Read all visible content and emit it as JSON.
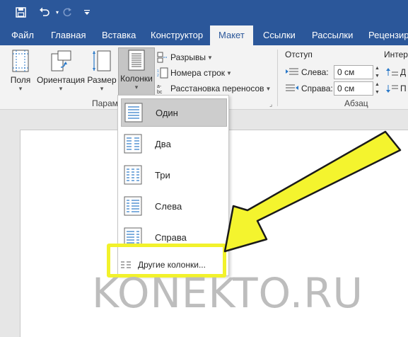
{
  "quick_access": {
    "save_icon": "save-icon",
    "undo_icon": "undo-icon",
    "redo_icon": "redo-icon",
    "customize_icon": "customize-qat-icon"
  },
  "tabs": [
    {
      "label": "Файл",
      "active": false
    },
    {
      "label": "Главная",
      "active": false
    },
    {
      "label": "Вставка",
      "active": false
    },
    {
      "label": "Конструктор",
      "active": false
    },
    {
      "label": "Макет",
      "active": true
    },
    {
      "label": "Ссылки",
      "active": false
    },
    {
      "label": "Рассылки",
      "active": false
    },
    {
      "label": "Рецензиро",
      "active": false
    }
  ],
  "ribbon": {
    "page_setup": {
      "margins_label": "Поля",
      "orientation_label": "Ориентация",
      "size_label": "Размер",
      "columns_label": "Колонки",
      "breaks_label": "Разрывы",
      "line_numbers_label": "Номера строк",
      "hyphenation_label": "Расстановка переносов",
      "group_label": "Парам"
    },
    "paragraph": {
      "indent_title": "Отступ",
      "left_label": "Слева:",
      "left_value": "0 см",
      "right_label": "Справа:",
      "right_value": "0 см",
      "spacing_title_partial": "Интер",
      "spacing_before_partial": "Д",
      "spacing_after_partial": "П",
      "group_label": "Абзац"
    }
  },
  "columns_menu": {
    "items": [
      {
        "label": "Один",
        "selected": true,
        "icon": "one-column-icon"
      },
      {
        "label": "Два",
        "selected": false,
        "icon": "two-columns-icon"
      },
      {
        "label": "Три",
        "selected": false,
        "icon": "three-columns-icon"
      },
      {
        "label": "Слева",
        "selected": false,
        "icon": "left-column-icon"
      },
      {
        "label": "Справа",
        "selected": false,
        "icon": "right-column-icon"
      }
    ],
    "more_label": "Другие колонки..."
  },
  "watermark": "KONEKTO.RU",
  "colors": {
    "accent": "#2b579a",
    "highlight": "#f2f22b",
    "ribbon_bg": "#f3f3f3"
  }
}
